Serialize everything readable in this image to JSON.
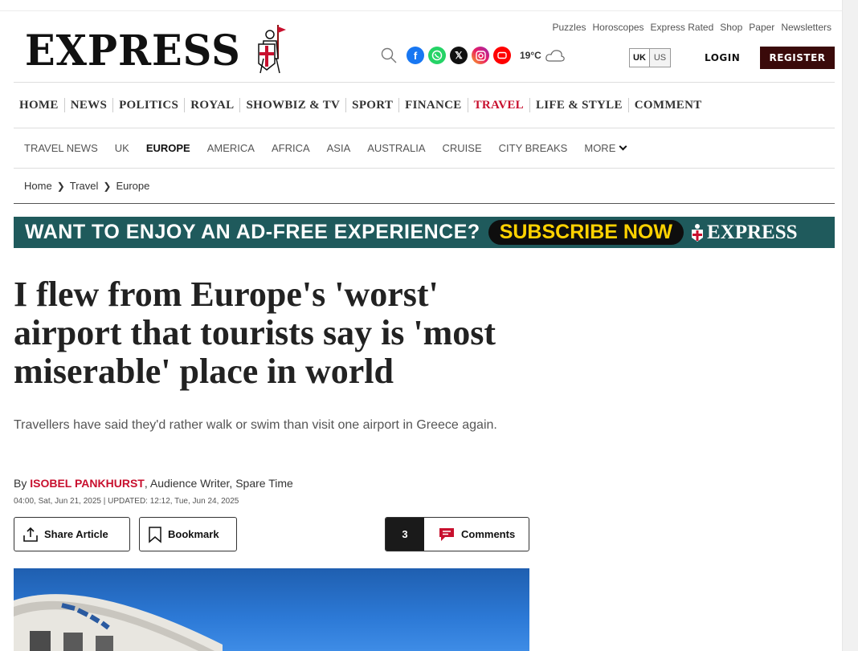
{
  "header": {
    "logo_text": "EXPRESS",
    "top_links": [
      "Puzzles",
      "Horoscopes",
      "Express Rated",
      "Shop",
      "Paper",
      "Newsletters"
    ],
    "social_icons": [
      "facebook-icon",
      "whatsapp-icon",
      "x-icon",
      "instagram-icon",
      "youtube-icon"
    ],
    "weather": {
      "temperature": "19°C",
      "icon": "cloud-icon"
    },
    "edition": {
      "selected": "UK",
      "other": "US"
    },
    "login_label": "LOGIN",
    "register_label": "REGISTER"
  },
  "main_nav": {
    "items": [
      {
        "label": "HOME"
      },
      {
        "label": "NEWS"
      },
      {
        "label": "POLITICS"
      },
      {
        "label": "ROYAL"
      },
      {
        "label": "SHOWBIZ & TV"
      },
      {
        "label": "SPORT"
      },
      {
        "label": "FINANCE"
      },
      {
        "label": "TRAVEL",
        "active": true
      },
      {
        "label": "LIFE & STYLE"
      },
      {
        "label": "COMMENT"
      }
    ]
  },
  "sub_nav": {
    "items": [
      {
        "label": "TRAVEL NEWS"
      },
      {
        "label": "UK"
      },
      {
        "label": "EUROPE",
        "active": true
      },
      {
        "label": "AMERICA"
      },
      {
        "label": "AFRICA"
      },
      {
        "label": "ASIA"
      },
      {
        "label": "AUSTRALIA"
      },
      {
        "label": "CRUISE"
      },
      {
        "label": "CITY BREAKS"
      },
      {
        "label": "MORE"
      }
    ]
  },
  "breadcrumb": [
    "Home",
    "Travel",
    "Europe"
  ],
  "banner": {
    "text": "WANT TO ENJOY AN AD-FREE EXPERIENCE?",
    "cta": "SUBSCRIBE NOW",
    "logo": "EXPRESS",
    "colors": {
      "background": "#1f5a5c",
      "cta_text": "#ffd200"
    }
  },
  "article": {
    "headline": "I flew from Europe's 'worst' airport that tourists say is 'most miserable' place in world",
    "standfirst": "Travellers have said they'd rather walk or swim than visit one airport in Greece again.",
    "byline_prefix": "By ",
    "author": "ISOBEL PANKHURST",
    "author_role": ", Audience Writer, Spare Time",
    "dateline": "04:00, Sat, Jun 21, 2025 | UPDATED: 12:12, Tue, Jun 24, 2025",
    "share_label": "Share Article",
    "bookmark_label": "Bookmark",
    "comments_count": "3",
    "comments_label": "Comments"
  },
  "colors": {
    "accent": "#c8102e",
    "register_bg": "#3a0a0a"
  }
}
